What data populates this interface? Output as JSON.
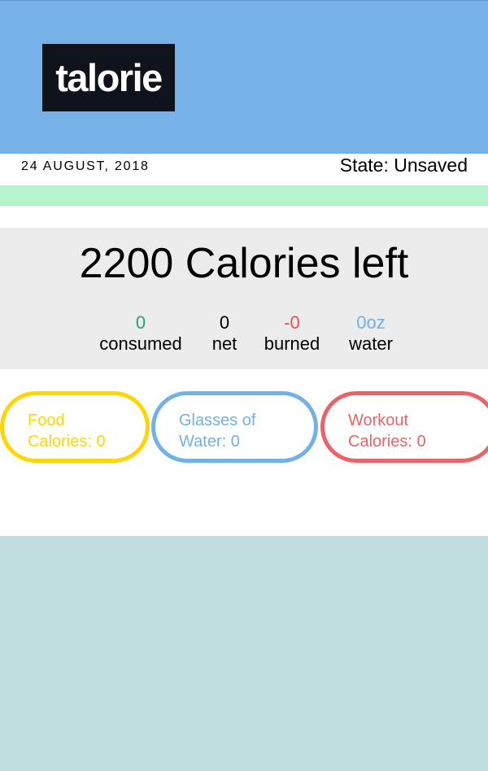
{
  "app": {
    "logo_text": "talorie"
  },
  "infobar": {
    "date": "24 AUGUST, 2018",
    "state": "State: Unsaved"
  },
  "progress": {
    "fraction": 0
  },
  "summary": {
    "remaining": "2200 Calories left",
    "stats": {
      "consumed": {
        "value": "0",
        "label": "consumed"
      },
      "net": {
        "value": "0",
        "label": "net"
      },
      "burned": {
        "value": "-0",
        "label": "burned"
      },
      "water": {
        "value": "0oz",
        "label": "water"
      }
    }
  },
  "buttons": {
    "food": {
      "line1": "Food",
      "line2": "Calories: 0"
    },
    "water": {
      "line1": "Glasses of",
      "line2": "Water: 0"
    },
    "workout": {
      "line1": "Workout",
      "line2": "Calories: 0"
    }
  },
  "colors": {
    "header": "#76b2e7",
    "progress_track": "#b5f3cc",
    "consumed": "#2aa66c",
    "net": "#000000",
    "burned": "#e7524f",
    "water": "#72b1e5",
    "food": "#ffd600",
    "workout": "#eb6366",
    "background": "#c2dfe0"
  }
}
